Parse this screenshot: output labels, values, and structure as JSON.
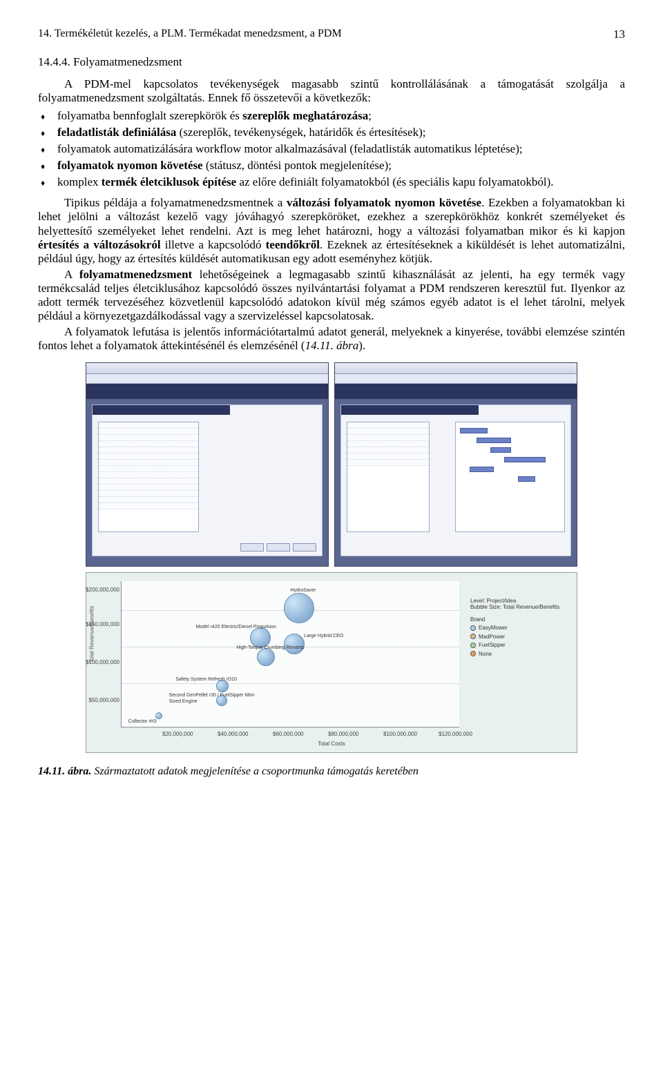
{
  "header": {
    "running_title": "14. Termékéletút kezelés, a PLM. Termékadat menedzsment, a PDM",
    "page_number": "13"
  },
  "section": {
    "number_title": "14.4.4. Folyamatmenedzsment",
    "intro": "A PDM-mel kapcsolatos tevékenységek magasabb szintű kontrollálásának a támogatását szolgálja a folyamatmenedzsment szolgáltatás. Ennek fő összetevői a következők:",
    "bullets": {
      "b1_a": "folyamatba bennfoglalt szerepkörök és ",
      "b1_b": "szereplők meghatározása",
      "b1_c": ";",
      "b2_a": "feladatlisták definiálása",
      "b2_b": " (szereplők, tevékenységek, határidők és értesítések);",
      "b3_a": "folyamatok automatizálására",
      "b3_b": " workflow motor alkalmazásával (feladatlisták automatikus léptetése);",
      "b4_a": "folyamatok nyomon követése",
      "b4_b": " (státusz, döntési pontok megjelenítése);",
      "b5_a": "komplex ",
      "b5_b": "termék életciklusok építése",
      "b5_c": " az előre definiált folyamatokból (és speciális kapu folyamatokból)."
    },
    "para2_a": "Tipikus példája a folyamatmenedzsmentnek a ",
    "para2_b": "változási folyamatok nyomon követése",
    "para2_c": ". Ezekben a folyamatokban ki lehet jelölni a változást kezelő vagy jóváhagyó szerepköröket, ezekhez a szerepkörökhöz konkrét személyeket és helyettesítő  személyeket lehet rendelni. Azt is meg lehet határozni, hogy a változási folyamatban mikor és ki kapjon ",
    "para2_d": "értesítés a változásokról",
    "para2_e": " illetve a kapcsolódó ",
    "para2_f": "teendőkről",
    "para2_g": ". Ezeknek az értesítéseknek a kiküldését is lehet automatizálni, például úgy, hogy az értesítés küldését automatikusan egy adott eseményhez kötjük.",
    "para3_a": "A ",
    "para3_b": "folyamatmenedzsment",
    "para3_c": " lehetőségeinek a legmagasabb szintű kihasználását az jelenti, ha egy termék vagy termékcsalád teljes életciklusához kapcsolódó összes nyilvántartási folyamat a PDM rendszeren keresztül fut. Ilyenkor az adott termék tervezéséhez közvetlenül kapcsolódó adatokon kívül még számos egyéb adatot is el lehet tárolni, melyek például a környezetgazdálkodással vagy a szervizeléssel kapcsolatosak.",
    "para4_a": "A folyamatok lefutása is jelentős információtartalmú adatot generál, melyeknek a kinyerése, további elemzése szintén fontos lehet a folyamatok áttekintésénél és elemzésénél (",
    "para4_b": "14.11. ábra",
    "para4_c": ")."
  },
  "chart_data": {
    "type": "scatter",
    "title": "",
    "xlabel": "Total Costs",
    "ylabel": "Total Revenue/Benefits",
    "xlim": [
      0,
      120000000
    ],
    "ylim": [
      0,
      200000000
    ],
    "x_ticks": [
      "$20,000,000",
      "$40,000,000",
      "$60,000,000",
      "$80,000,000",
      "$100,000,000",
      "$120,000,000"
    ],
    "y_ticks": [
      "$50,000,000",
      "$100,000,000",
      "$150,000,000",
      "$200,000,000"
    ],
    "series": [
      {
        "name": "HydroSaver",
        "x": 65000000,
        "y": 170000000
      },
      {
        "name": "Model r420 Electric/Diesel Propulsion",
        "x": 55000000,
        "y": 125000000
      },
      {
        "name": "Large Hybrid CEO",
        "x": 65000000,
        "y": 120000000
      },
      {
        "name": "High-Torque Crumbing Revamp",
        "x": 55000000,
        "y": 100000000
      },
      {
        "name": "Safety System Refresh rD10",
        "x": 40000000,
        "y": 50000000
      },
      {
        "name": "Second GenPellet r30 / FuelSipper Mini-Sized Engine",
        "x": 40000000,
        "y": 35000000
      },
      {
        "name": "Collector rH3",
        "x": 18000000,
        "y": 10000000
      }
    ],
    "legend": {
      "title1": "Level: Project/Idea",
      "title2": "Bubble Size: Total Revenue/Benefits",
      "subtitle": "Brand",
      "items": [
        {
          "name": "EasyMower",
          "color": "#a8d0e8"
        },
        {
          "name": "MadPower",
          "color": "#e0c080"
        },
        {
          "name": "FuelSipper",
          "color": "#a8d8a0"
        },
        {
          "name": "None",
          "color": "#f0a060"
        }
      ]
    }
  },
  "caption": {
    "label": "14.11. ábra.",
    "text": " Származtatott adatok megjelenítése a csoportmunka támogatás keretében"
  }
}
